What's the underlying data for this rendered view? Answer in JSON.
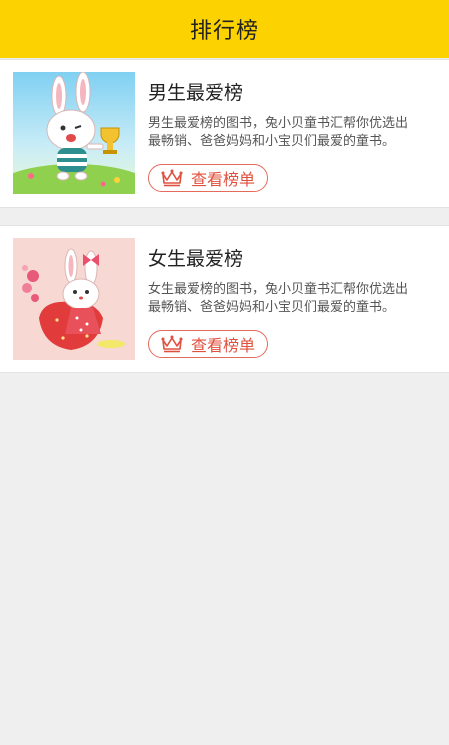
{
  "header": {
    "title": "排行榜"
  },
  "lists": [
    {
      "title": "男生最爱榜",
      "desc_line1": "男生最爱榜的图书，兔小贝童书汇帮你优选出",
      "desc_line2": "最畅销、爸爸妈妈和小宝贝们最爱的童书。",
      "button_label": "查看榜单",
      "thumbnail_icon": "bunny-trophy-image",
      "accent": "#e0503e"
    },
    {
      "title": "女生最爱榜",
      "desc_line1": "女生最爱榜的图书，兔小贝童书汇帮你优选出",
      "desc_line2": "最畅销、爸爸妈妈和小宝贝们最爱的童书。",
      "button_label": "查看榜单",
      "thumbnail_icon": "bunny-strawberry-image",
      "accent": "#e0503e"
    }
  ],
  "colors": {
    "header_bg": "#fcd300",
    "page_bg": "#efefef"
  }
}
